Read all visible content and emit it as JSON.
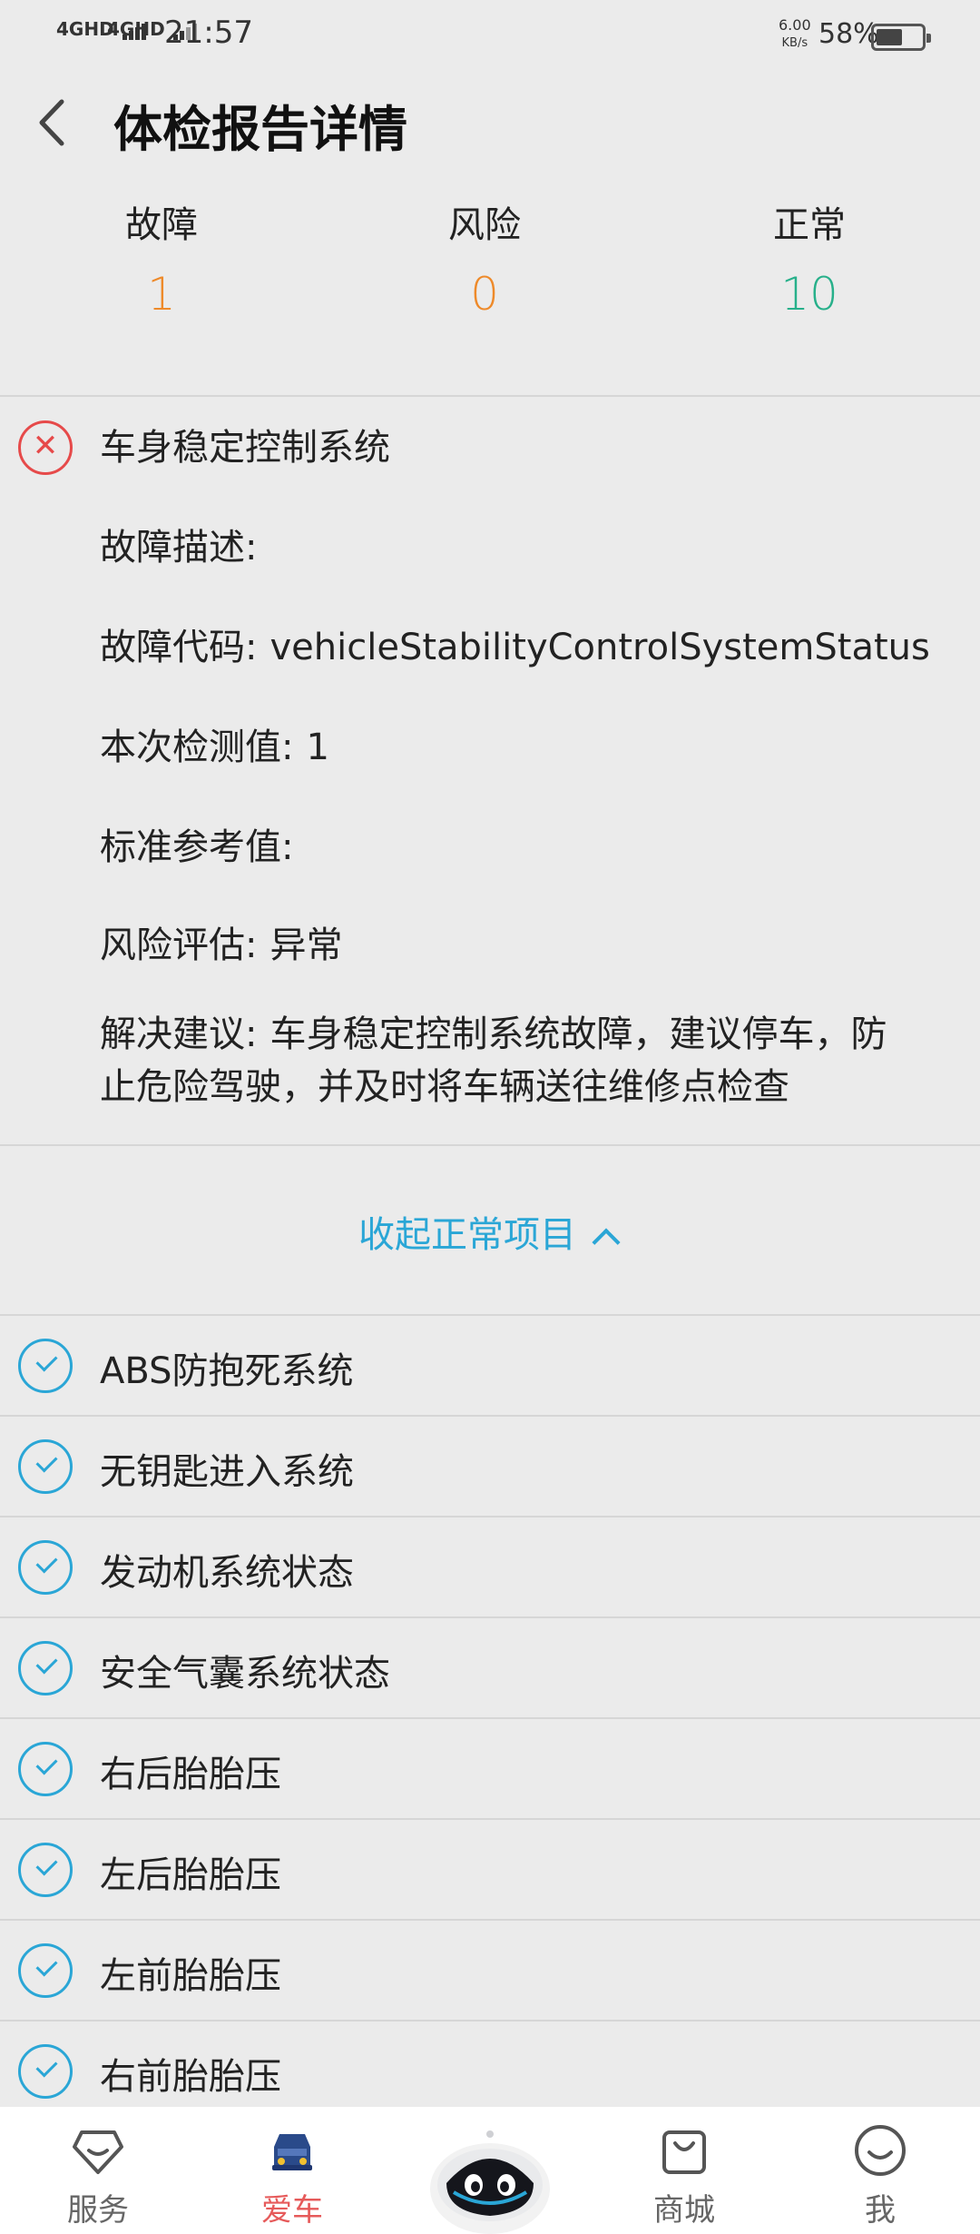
{
  "status_bar": {
    "signal1": "4GHD",
    "signal2": "4GHD",
    "time": "21:57",
    "net_speed_value": "6.00",
    "net_speed_unit": "KB/s",
    "battery": "58%",
    "battery_level": 0.58
  },
  "header": {
    "title": "体检报告详情"
  },
  "summary": {
    "fault_label": "故障",
    "fault_count": "1",
    "risk_label": "风险",
    "risk_count": "0",
    "normal_label": "正常",
    "normal_count": "10",
    "colors": {
      "fault": "#ee8a2a",
      "risk": "#ee8a2a",
      "normal": "#27b08a"
    }
  },
  "fault": {
    "title": "车身稳定控制系统",
    "desc_label": "故障描述:",
    "code_label": "故障代码:",
    "code_value": "vehicleStabilityControlSystemStatus",
    "measured_label": "本次检测值:",
    "measured_value": "1",
    "reference_label": "标准参考值:",
    "risk_label": "风险评估:",
    "risk_value": "异常",
    "advice_label": "解决建议:",
    "advice_value": "车身稳定控制系统故障，建议停车，防止危险驾驶，并及时将车辆送往维修点检查"
  },
  "collapse": {
    "label": "收起正常项目"
  },
  "normal_items": [
    "ABS防抱死系统",
    "无钥匙进入系统",
    "发动机系统状态",
    "安全气囊系统状态",
    "右后胎胎压",
    "左后胎胎压",
    "左前胎胎压",
    "右前胎胎压"
  ],
  "bottom_nav": {
    "service": "服务",
    "car": "爱车",
    "mall": "商城",
    "me": "我",
    "active_color": "#e65a5a"
  }
}
